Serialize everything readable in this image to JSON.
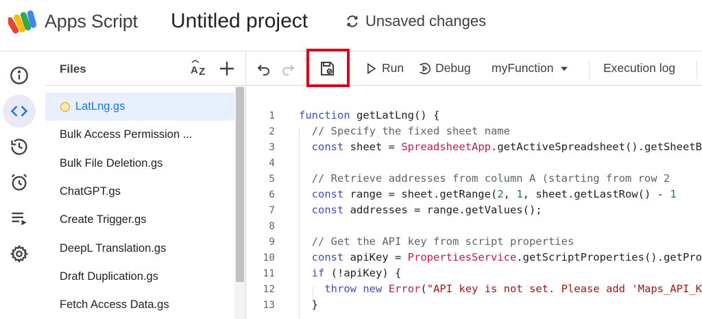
{
  "header": {
    "app_name": "Apps Script",
    "project_title": "Untitled project",
    "status": "Unsaved changes"
  },
  "rail": {
    "items": [
      {
        "icon": "info-icon",
        "active": false
      },
      {
        "icon": "code-icon",
        "active": true
      },
      {
        "icon": "history-icon",
        "active": false
      },
      {
        "icon": "alarm-icon",
        "active": false
      },
      {
        "icon": "executions-icon",
        "active": false
      },
      {
        "icon": "gear-icon",
        "active": false
      }
    ]
  },
  "files": {
    "title": "Files",
    "items": [
      {
        "label": "LatLng.gs",
        "active": true
      },
      {
        "label": "Bulk Access Permission ...",
        "active": false
      },
      {
        "label": "Bulk File Deletion.gs",
        "active": false
      },
      {
        "label": "ChatGPT.gs",
        "active": false
      },
      {
        "label": "Create Trigger.gs",
        "active": false
      },
      {
        "label": "DeepL Translation.gs",
        "active": false
      },
      {
        "label": "Draft Duplication.gs",
        "active": false
      },
      {
        "label": "Fetch Access Data.gs",
        "active": false
      }
    ]
  },
  "toolbar": {
    "run_label": "Run",
    "debug_label": "Debug",
    "function_label": "myFunction",
    "exec_log_label": "Execution log"
  },
  "editor": {
    "line_numbers": [
      "1",
      "2",
      "3",
      "4",
      "5",
      "6",
      "7",
      "8",
      "9",
      "10",
      "11",
      "12",
      "13"
    ]
  },
  "colors": {
    "accent": "#1a73e8",
    "highlight_box": "#d6001c",
    "keyword": "#3f4fb5",
    "class_name": "#c2185b"
  }
}
